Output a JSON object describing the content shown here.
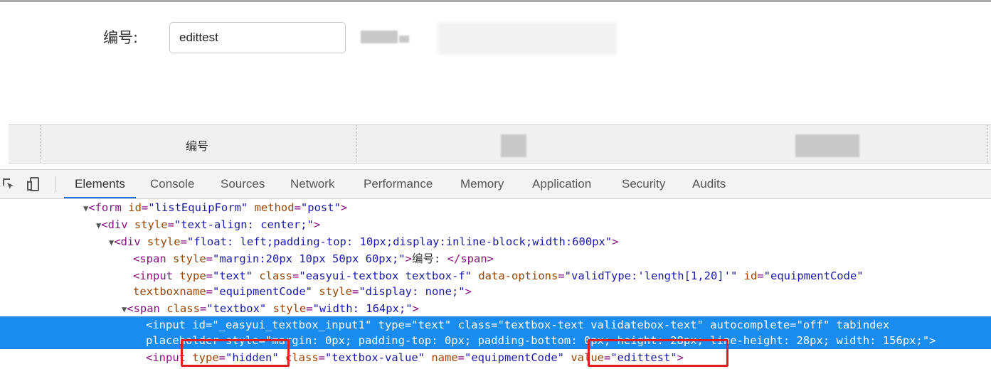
{
  "form": {
    "label": "编号:",
    "input_value": "edittest"
  },
  "grid": {
    "header": "编号"
  },
  "devtools": {
    "tabs": [
      "Elements",
      "Console",
      "Sources",
      "Network",
      "Performance",
      "Memory",
      "Application",
      "Security",
      "Audits"
    ],
    "active_tab": "Elements",
    "lines": {
      "l1": {
        "open": "<form",
        "a1": " id",
        "v1": "\"listEquipForm\"",
        "a2": " method",
        "v2": "\"post\"",
        "close": ">"
      },
      "l2": {
        "open": "<div",
        "a1": " style",
        "v1": "\"text-align: center;\"",
        "close": ">"
      },
      "l3": {
        "open": "<div",
        "a1": " style",
        "v1": "\"float: left;padding-top: 10px;display:inline-block;width:600px\"",
        "close": ">"
      },
      "l4": {
        "open": "<span",
        "a1": " style",
        "v1": "\"margin:20px 10px 50px 60px;\"",
        "close": ">",
        "text": "编号: ",
        "end": "</span>"
      },
      "l5": {
        "open": "<input",
        "a1": " type",
        "v1": "\"text\"",
        "a2": " class",
        "v2": "\"easyui-textbox textbox-f\"",
        "a3": " data-options",
        "v3": "\"validType:'length[1,20]'\"",
        "a4": " id",
        "v4": "\"equipmentCode\""
      },
      "l6": {
        "a1": "textboxname",
        "v1": "\"equipmentCode\"",
        "a2": " style",
        "v2": "\"display: none;\"",
        "close": ">"
      },
      "l7": {
        "open": "<span",
        "a1": " class",
        "v1": "\"textbox\"",
        "a2": " style",
        "v2": "\"width: 164px;\"",
        "close": ">"
      },
      "l8": "<input id=\"_easyui_textbox_input1\" type=\"text\" class=\"textbox-text validatebox-text\" autocomplete=\"off\" tabindex",
      "l9": "placeholder style=\"margin: 0px; padding-top: 0px; padding-bottom: 0px; height: 28px; line-height: 28px; width: 156px;\">",
      "l10": {
        "open": "<input",
        "a1": " type",
        "v1": "\"hidden\"",
        "a2": " class",
        "v2": "\"textbox-value\"",
        "a3": " name",
        "v3": "\"equipmentCode\"",
        "a4": " value",
        "v4": "\"edittest\"",
        "close": ">"
      }
    }
  },
  "colors": {
    "highlight": "#1a8cf0",
    "annotation": "#e02020",
    "accent": "#1a73e8"
  }
}
